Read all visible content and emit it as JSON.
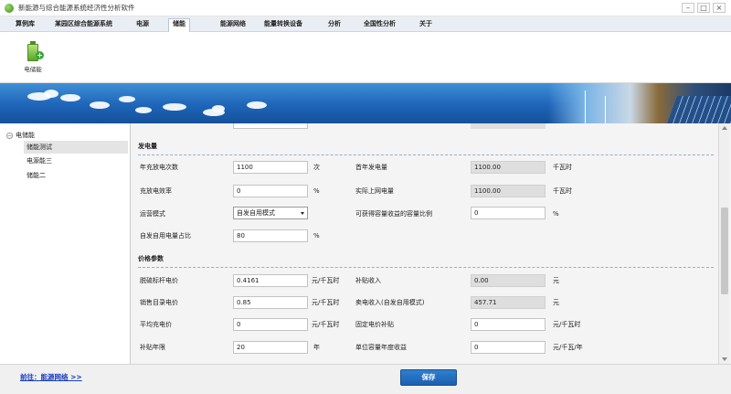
{
  "window": {
    "title": "新能源与综合能源系统经济性分析软件",
    "controls": {
      "minimize": "–",
      "maximize": "□",
      "close": "×"
    }
  },
  "menu": {
    "items": [
      {
        "label": "算例库"
      },
      {
        "label": "某园区综合能源系统"
      },
      {
        "label": "电源"
      },
      {
        "label": "储能",
        "active": true
      },
      {
        "label": "能源网络"
      },
      {
        "label": "能量转换设备"
      },
      {
        "label": "分析"
      },
      {
        "label": "全国性分析"
      },
      {
        "label": "关于"
      }
    ]
  },
  "ribbon": {
    "button_label": "电储能",
    "icon": "battery-add-icon"
  },
  "tree": {
    "root": {
      "toggle": "−",
      "label": "电储能"
    },
    "items": [
      {
        "label": "储能测试",
        "selected": true
      },
      {
        "label": "电源能三"
      },
      {
        "label": "储能二"
      }
    ]
  },
  "sections": {
    "power": {
      "title": "发电量"
    },
    "price": {
      "title": "价格参数"
    }
  },
  "power_rows": {
    "cycles": {
      "label": "年充放电次数",
      "value": "1100",
      "unit": "次"
    },
    "first_year_gen": {
      "label": "首年发电量",
      "value": "1100.00",
      "unit": "千瓦时"
    },
    "efficiency": {
      "label": "充放电效率",
      "value": "0",
      "unit": "%"
    },
    "grid_energy": {
      "label": "实际上网电量",
      "value": "1100.00",
      "unit": "千瓦时"
    },
    "mode": {
      "label": "运营模式",
      "value": "自发自用模式"
    },
    "capacity_ratio": {
      "label": "可获得容量收益的容量比例",
      "value": "0",
      "unit": "%"
    },
    "self_use": {
      "label": "自发自用电量占比",
      "value": "80",
      "unit": "%"
    }
  },
  "price_rows": {
    "benchmark": {
      "label": "脱硫标杆电价",
      "value": "0.4161",
      "unit": "元/千瓦时"
    },
    "subsidy_income": {
      "label": "补贴收入",
      "value": "0.00",
      "unit": "元"
    },
    "catalog": {
      "label": "销售目录电价",
      "value": "0.85",
      "unit": "元/千瓦时"
    },
    "sales_income": {
      "label": "卖电收入(自发自用模式)",
      "value": "457.71",
      "unit": "元"
    },
    "avg_charge": {
      "label": "平均充电价",
      "value": "0",
      "unit": "元/千瓦时"
    },
    "fixed_subsidy": {
      "label": "固定电价补贴",
      "value": "0",
      "unit": "元/千瓦时"
    },
    "subsidy_years": {
      "label": "补贴年限",
      "value": "20",
      "unit": "年"
    },
    "capacity_income": {
      "label": "单位容量年度收益",
      "value": "0",
      "unit": "元/千瓦/年"
    }
  },
  "footer": {
    "goto_link": "前往：能源网络  >>",
    "save_button": "保存"
  }
}
